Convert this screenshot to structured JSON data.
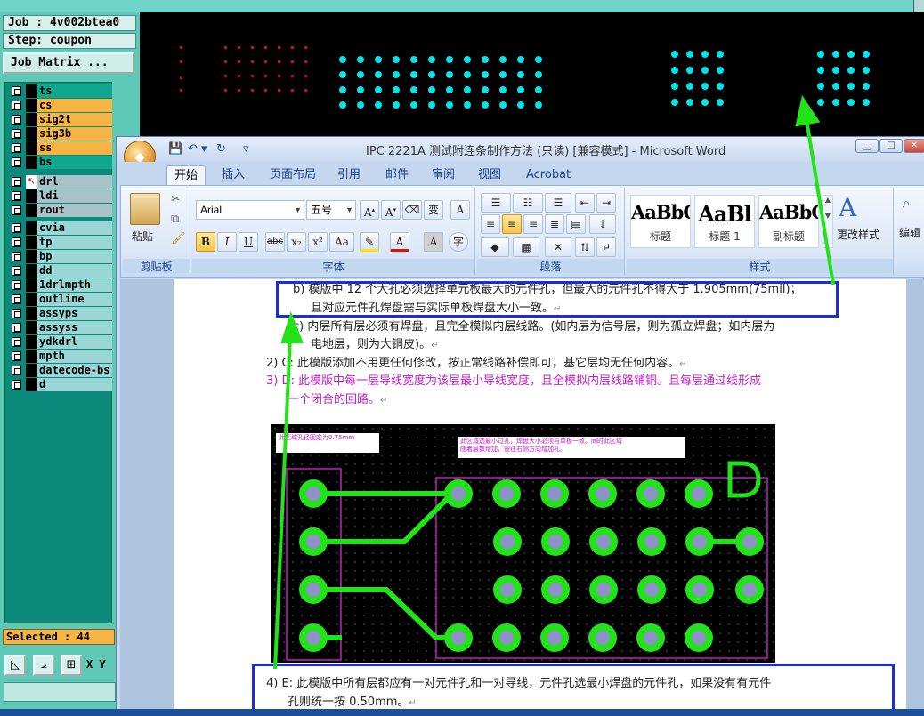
{
  "genesis": {
    "job_label": "Job : 4v002btea0",
    "step_label": "Step: coupon",
    "job_matrix_button": "Job Matrix ...",
    "layers": [
      {
        "name": "ts",
        "color": "#0fa88f"
      },
      {
        "name": "cs",
        "color": "#f6b444"
      },
      {
        "name": "sig2t",
        "color": "#f6b444"
      },
      {
        "name": "sig3b",
        "color": "#f6b444"
      },
      {
        "name": "ss",
        "color": "#f6b444"
      },
      {
        "name": "bs",
        "color": "#0fa88f"
      },
      {
        "name": "drl",
        "color": "#a9c2c8"
      },
      {
        "name": "ldi",
        "color": "#a9c2c8"
      },
      {
        "name": "rout",
        "color": "#a9c2c8"
      },
      {
        "name": "cvia",
        "color": "#9ad6d6"
      },
      {
        "name": "tp",
        "color": "#9ad6d6"
      },
      {
        "name": "bp",
        "color": "#9ad6d6"
      },
      {
        "name": "dd",
        "color": "#9ad6d6"
      },
      {
        "name": "1drlmpth",
        "color": "#9ad6d6"
      },
      {
        "name": "outline",
        "color": "#9ad6d6"
      },
      {
        "name": "assyps",
        "color": "#9ad6d6"
      },
      {
        "name": "assyss",
        "color": "#9ad6d6"
      },
      {
        "name": "ydkdrl",
        "color": "#9ad6d6"
      },
      {
        "name": "mpth",
        "color": "#9ad6d6"
      },
      {
        "name": "datecode-bs",
        "color": "#9ad6d6"
      },
      {
        "name": "d",
        "color": "#9ad6d6"
      }
    ],
    "selected_label": "Selected : 44",
    "xy_label": "X Y"
  },
  "word": {
    "title": "IPC 2221A 测试附连条制作方法 (只读) [兼容模式] - Microsoft Word",
    "office_button": "◆",
    "tabs": [
      "开始",
      "插入",
      "页面布局",
      "引用",
      "邮件",
      "审阅",
      "视图",
      "Acrobat"
    ],
    "clipboard": {
      "paste": "粘贴",
      "label": "剪贴板"
    },
    "font": {
      "name": "Arial",
      "size": "五号",
      "label": "字体"
    },
    "paragraph": {
      "label": "段落"
    },
    "styles": {
      "label": "样式",
      "items": [
        {
          "preview": "AaBbC",
          "name": "标题"
        },
        {
          "preview": "AaBl",
          "name": "标题 1"
        },
        {
          "preview": "AaBbC",
          "name": "副标题"
        }
      ],
      "change": "更改样式",
      "edit": "编辑"
    },
    "doc": {
      "line1": "b)  模版中 12 个大孔必须选择单元板最大的元件孔，但最大的元件孔不得大于 1.905mm(75mil)；",
      "line2": "且对应元件孔焊盘需与实际单板焊盘大小一致。",
      "line3": "c)  内层所有层必须有焊盘，且完全模拟内层线路。(如内层为信号层，则为孤立焊盘；如内层为",
      "line4": "电地层，则为大铜皮)。",
      "line5": "2)  C:    此模版添加不用更任何修改，按正常线路补偿即可，基它层均无任何内容。",
      "line6": "3)  D: 此模版中每一层导线宽度为该层最小导线宽度，且全模拟内层线路铺铜。且每层通过线形成",
      "line7": "一个闭合的回路。",
      "line8": "4)  E: 此模版中所有层都应有一对元件孔和一对导线，元件孔选最小焊盘的元件孔，如果没有有元件",
      "line9": "孔则统一按 0.50mm。",
      "return_mark": "↵",
      "pcb_note_left": "此区域孔径固定为0.75mm",
      "pcb_note_right1": "此区域选最小过孔，焊盘大小必须与单板一致。同时此区域",
      "pcb_note_right2": "随着层数增加，需往右侧方向增加孔。",
      "pcb_letter": "D"
    }
  },
  "colors": {
    "genesis_bg": "#5fc9b7",
    "annotation_blue": "#1a2fd6",
    "arrow_green": "#22e21a",
    "pad_green": "#22e21a",
    "magenta_text": "#c21ec8"
  }
}
